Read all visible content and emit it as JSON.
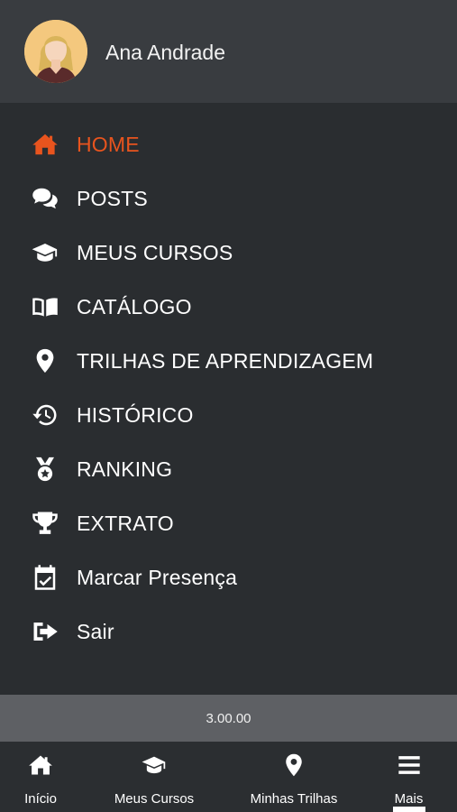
{
  "user": {
    "name": "Ana Andrade",
    "avatar_icon": "user-avatar-icon"
  },
  "menu": {
    "accent_color": "#e8541e",
    "items": [
      {
        "label": "HOME",
        "icon": "home-icon",
        "active": true
      },
      {
        "label": "POSTS",
        "icon": "comments-icon",
        "active": false
      },
      {
        "label": "MEUS CURSOS",
        "icon": "graduation-cap-icon",
        "active": false
      },
      {
        "label": "CATÁLOGO",
        "icon": "book-open-icon",
        "active": false
      },
      {
        "label": "TRILHAS DE APRENDIZAGEM",
        "icon": "map-pin-icon",
        "active": false
      },
      {
        "label": "HISTÓRICO",
        "icon": "history-icon",
        "active": false
      },
      {
        "label": "RANKING",
        "icon": "medal-icon",
        "active": false
      },
      {
        "label": "EXTRATO",
        "icon": "trophy-icon",
        "active": false
      },
      {
        "label": "Marcar Presença",
        "icon": "calendar-check-icon",
        "active": false
      },
      {
        "label": "Sair",
        "icon": "sign-out-icon",
        "active": false
      }
    ]
  },
  "version": "3.00.00",
  "bottom_nav": {
    "items": [
      {
        "label": "Início",
        "icon": "home-icon",
        "active": false
      },
      {
        "label": "Meus Cursos",
        "icon": "graduation-cap-icon",
        "active": false
      },
      {
        "label": "Minhas Trilhas",
        "icon": "map-pin-icon",
        "active": false
      },
      {
        "label": "Mais",
        "icon": "menu-icon",
        "active": true
      }
    ]
  }
}
